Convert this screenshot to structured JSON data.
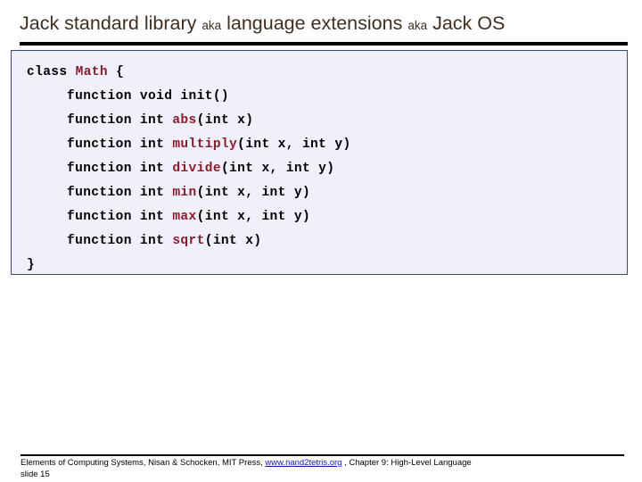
{
  "slide": {
    "title_main_1": "Jack standard library ",
    "title_aka_1": "aka",
    "title_main_2": " language extensions ",
    "title_aka_2": "aka",
    "title_main_3": " Jack OS",
    "title_full": "Jack standard library aka language extensions aka Jack OS",
    "title_color": "#3f2f20"
  },
  "code": {
    "language": "Jack",
    "background_color": "#f0f0fb",
    "border_color": "#3a4a6b",
    "identifier_color": "#8b1a2b",
    "text_color": "#000000",
    "lines": [
      {
        "indent": false,
        "prefix": "class ",
        "ident": "Math",
        "suffix": " {"
      },
      {
        "indent": true,
        "prefix": "function void init()",
        "ident": "",
        "suffix": ""
      },
      {
        "indent": true,
        "prefix": "function int ",
        "ident": "abs",
        "suffix": "(int x)"
      },
      {
        "indent": true,
        "prefix": "function int ",
        "ident": "multiply",
        "suffix": "(int x, int y)"
      },
      {
        "indent": true,
        "prefix": "function int ",
        "ident": "divide",
        "suffix": "(int x, int y)"
      },
      {
        "indent": true,
        "prefix": "function int ",
        "ident": "min",
        "suffix": "(int x, int y)"
      },
      {
        "indent": true,
        "prefix": "function int ",
        "ident": "max",
        "suffix": "(int x, int y)"
      },
      {
        "indent": true,
        "prefix": "function int ",
        "ident": "sqrt",
        "suffix": "(int x)"
      },
      {
        "indent": false,
        "prefix": "}",
        "ident": "",
        "suffix": ""
      }
    ]
  },
  "footer": {
    "credit_prefix": "Elements of Computing Systems, Nisan & Schocken, MIT Press, ",
    "link_text": "www.nand2tetris.org",
    "credit_suffix": " , Chapter 9: High-Level Language",
    "slide_number_text": "slide 15",
    "link_color": "#1414b4"
  }
}
